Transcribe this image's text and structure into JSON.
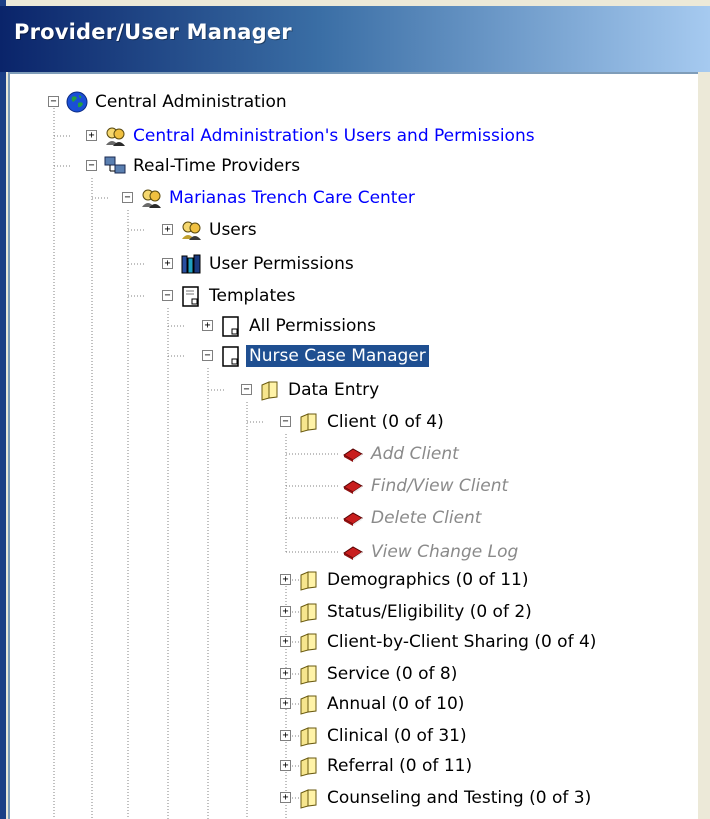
{
  "window": {
    "title": "Provider/User Manager"
  },
  "tree": {
    "root": {
      "label": "Central Administration",
      "icon": "globe-icon"
    },
    "central_users": {
      "label": "Central Administration's Users and Permissions",
      "icon": "users-icon"
    },
    "real_time": {
      "label": "Real-Time Providers",
      "icon": "network-icon"
    },
    "provider": {
      "label": "Marianas Trench Care Center",
      "icon": "users-icon"
    },
    "users": {
      "label": "Users",
      "icon": "users-icon"
    },
    "user_permissions": {
      "label": "User Permissions",
      "icon": "books-icon"
    },
    "templates": {
      "label": "Templates",
      "icon": "document-icon"
    },
    "all_permissions": {
      "label": "All Permissions",
      "icon": "document-icon"
    },
    "nurse_case_manager": {
      "label": "Nurse Case Manager",
      "icon": "document-icon"
    },
    "data_entry": {
      "label": "Data Entry",
      "icon": "folder-icon"
    },
    "client": {
      "label": "Client (0 of 4)",
      "icon": "folder-icon",
      "children": [
        {
          "label": "Add Client",
          "icon": "red-book-icon"
        },
        {
          "label": "Find/View Client",
          "icon": "red-book-icon"
        },
        {
          "label": "Delete Client",
          "icon": "red-book-icon"
        },
        {
          "label": "View Change Log",
          "icon": "red-book-icon"
        }
      ]
    },
    "categories": [
      {
        "label": "Demographics (0 of 11)"
      },
      {
        "label": "Status/Eligibility (0 of 2)"
      },
      {
        "label": "Client-by-Client Sharing (0 of 4)"
      },
      {
        "label": "Service (0 of 8)"
      },
      {
        "label": "Annual (0 of 10)"
      },
      {
        "label": "Clinical (0 of 31)"
      },
      {
        "label": "Referral (0 of 11)"
      },
      {
        "label": "Counseling and Testing (0 of 3)"
      }
    ],
    "expander_plus": "+",
    "expander_minus": "−"
  },
  "colors": {
    "selection": "#1f4f91",
    "link": "#0000ff",
    "disabled": "#8a8a8a"
  }
}
